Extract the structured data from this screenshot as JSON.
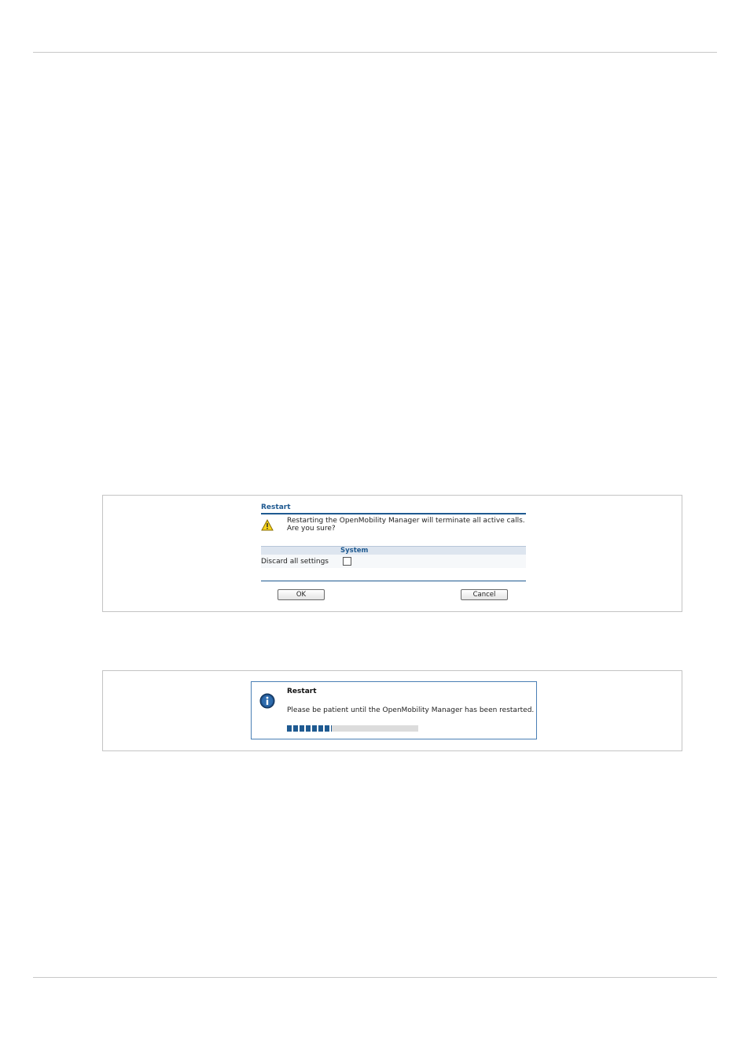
{
  "restart_confirm_dialog": {
    "title": "Restart",
    "warning_icon": "warning-triangle-icon",
    "warning_line1": "Restarting the OpenMobility Manager will terminate all active calls.",
    "warning_line2": "Are you sure?",
    "section_header": "System",
    "discard_label": "Discard all settings",
    "discard_checked": false,
    "ok_label": "OK",
    "cancel_label": "Cancel",
    "accent_color": "#1f5a91"
  },
  "restart_progress_dialog": {
    "title": "Restart",
    "info_icon": "info-icon",
    "message": "Please be patient until the OpenMobility Manager has been restarted.",
    "progress_fraction": 0.34
  }
}
